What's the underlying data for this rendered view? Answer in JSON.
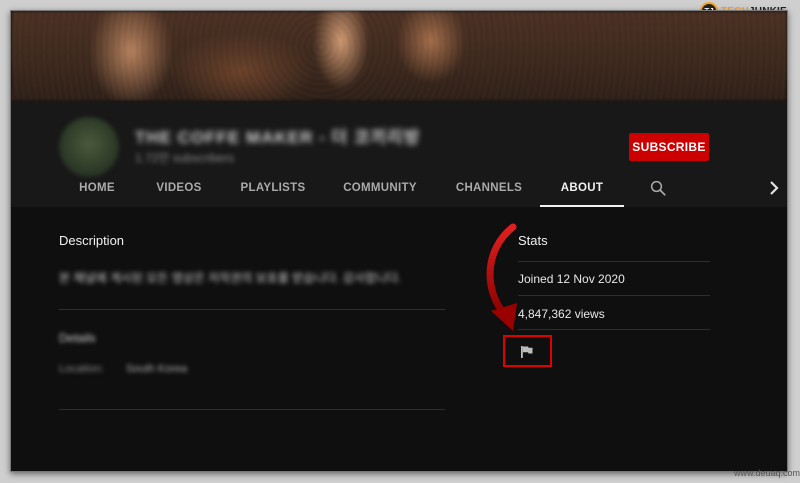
{
  "watermark": {
    "badge": "TJ",
    "tech": "TECH",
    "junkie": "JUNKIE"
  },
  "site_mark": "www.deuaq.com",
  "channel": {
    "name": "THE COFFE MAKER - 더 코끼리방",
    "subscribers": "1.72만 subscribers",
    "subscribe_label": "SUBSCRIBE"
  },
  "tabs": [
    {
      "label": "HOME"
    },
    {
      "label": "VIDEOS"
    },
    {
      "label": "PLAYLISTS"
    },
    {
      "label": "COMMUNITY"
    },
    {
      "label": "CHANNELS"
    },
    {
      "label": "ABOUT"
    }
  ],
  "description": {
    "title": "Description",
    "text": "본 채널에 게시된 모든 영상은 저작권의 보호를 받습니다. 감사합니다."
  },
  "details": {
    "title": "Details",
    "location_label": "Location:",
    "location_value": "South Korea"
  },
  "stats": {
    "title": "Stats",
    "joined": "Joined 12 Nov 2020",
    "views": "4,847,362 views"
  },
  "colors": {
    "subscribe": "#cc0000",
    "highlight_box": "#e00000",
    "arrow": "#c00000",
    "background": "#0f0f0f"
  },
  "icons": {
    "search": "search-icon",
    "next": "chevron-right-icon",
    "flag": "flag-icon",
    "arrow": "curved-arrow-icon"
  }
}
